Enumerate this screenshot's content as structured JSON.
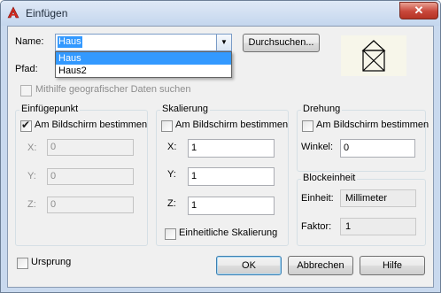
{
  "window": {
    "title": "Einfügen",
    "close_label": "✕"
  },
  "name": {
    "label": "Name:",
    "value": "Haus",
    "options": [
      "Haus",
      "Haus2"
    ],
    "selected_option": "Haus",
    "browse_label": "Durchsuchen..."
  },
  "path": {
    "label": "Pfad:",
    "value": ""
  },
  "geo": {
    "label": "Mithilfe geografischer Daten suchen",
    "checked": false,
    "enabled": false
  },
  "insertion_point": {
    "title": "Einfügepunkt",
    "on_screen_label": "Am Bildschirm bestimmen",
    "on_screen_checked": true,
    "x_label": "X:",
    "x_value": "0",
    "y_label": "Y:",
    "y_value": "0",
    "z_label": "Z:",
    "z_value": "0"
  },
  "scale": {
    "title": "Skalierung",
    "on_screen_label": "Am Bildschirm bestimmen",
    "on_screen_checked": false,
    "x_label": "X:",
    "x_value": "1",
    "y_label": "Y:",
    "y_value": "1",
    "z_label": "Z:",
    "z_value": "1",
    "uniform_label": "Einheitliche Skalierung",
    "uniform_checked": false
  },
  "rotation": {
    "title": "Drehung",
    "on_screen_label": "Am Bildschirm bestimmen",
    "on_screen_checked": false,
    "angle_label": "Winkel:",
    "angle_value": "0"
  },
  "block_unit": {
    "title": "Blockeinheit",
    "unit_label": "Einheit:",
    "unit_value": "Millimeter",
    "factor_label": "Faktor:",
    "factor_value": "1"
  },
  "origin": {
    "label": "Ursprung",
    "checked": false
  },
  "buttons": {
    "ok": "OK",
    "cancel": "Abbrechen",
    "help": "Hilfe"
  },
  "colors": {
    "title_bar": "#c4d6ee",
    "selection": "#3399ff",
    "close": "#c8473a"
  }
}
